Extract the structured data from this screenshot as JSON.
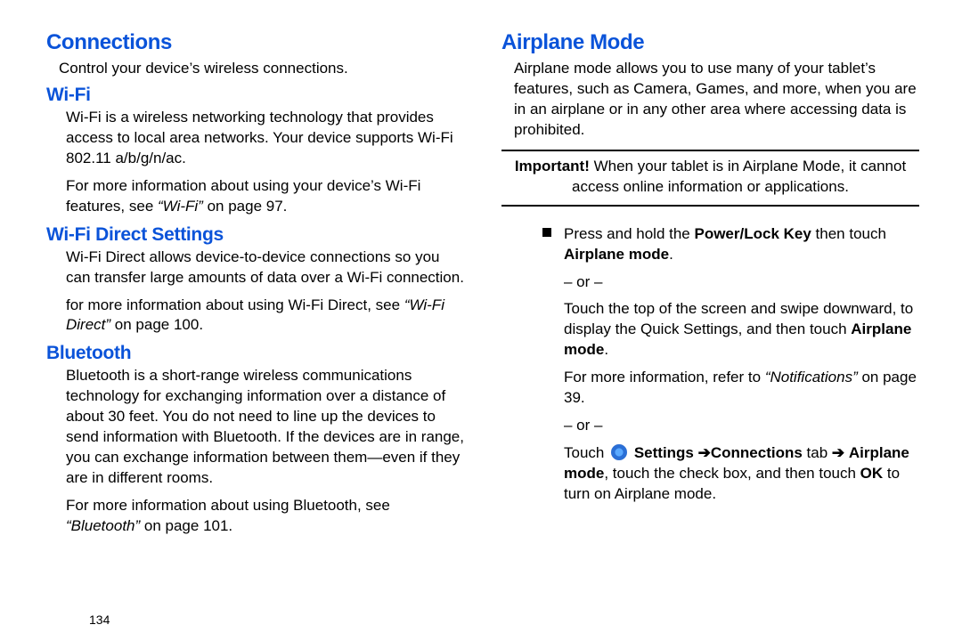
{
  "left": {
    "h1": "Connections",
    "introText": "Control your device’s wireless connections.",
    "wifi": {
      "title": "Wi-Fi",
      "p1": "Wi-Fi is a wireless networking technology that provides access to local area networks. Your device supports Wi-Fi 802.11 a/b/g/n/ac.",
      "p2a": "For more information about using your device’s Wi-Fi features, see ",
      "p2xref": "“Wi-Fi”",
      "p2b": " on page 97."
    },
    "direct": {
      "title": "Wi-Fi Direct Settings",
      "p1": "Wi-Fi Direct allows device-to-device connections so you can transfer large amounts of data over a Wi-Fi connection.",
      "p2a": "for more information about using Wi-Fi Direct, see ",
      "p2xref": "“Wi-Fi Direct”",
      "p2b": " on page 100."
    },
    "bt": {
      "title": "Bluetooth",
      "p1": "Bluetooth is a short-range wireless communications technology for exchanging information over a distance of about 30 feet. You do not need to line up the devices to send information with Bluetooth. If the devices are in range, you can exchange information between them—even if they are in different rooms.",
      "p2a": "For more information about using Bluetooth, see ",
      "p2xref": "“Bluetooth”",
      "p2b": " on page 101."
    },
    "pageNumber": "134"
  },
  "right": {
    "h1": "Airplane Mode",
    "p1": "Airplane mode allows you to use many of your tablet’s features, such as Camera, Games, and more, when you are in an airplane or in any other area where accessing data is prohibited.",
    "importantLead": "Important!",
    "importantBody": " When your tablet is in Airplane Mode, it cannot access online information or applications.",
    "step1a": "Press and hold the ",
    "step1b": "Power/Lock Key",
    "step1c": " then touch ",
    "step1d": "Airplane mode",
    "step1e": ".",
    "or": "– or –",
    "step2a": "Touch the top of the screen and swipe downward, to display the Quick Settings, and then touch ",
    "step2b": "Airplane mode",
    "step2c": ".",
    "step2refA": "For more information, refer to ",
    "step2refXref": "“Notifications”",
    "step2refB": " on page 39.",
    "step3touch": "Touch ",
    "step3settings": "Settings",
    "step3conn": "Connections",
    "step3tab": " tab",
    "step3mode": "Airplane mode",
    "step3rest": ", touch the check box, and then touch ",
    "step3ok": "OK",
    "step3end": " to turn on Airplane mode."
  }
}
